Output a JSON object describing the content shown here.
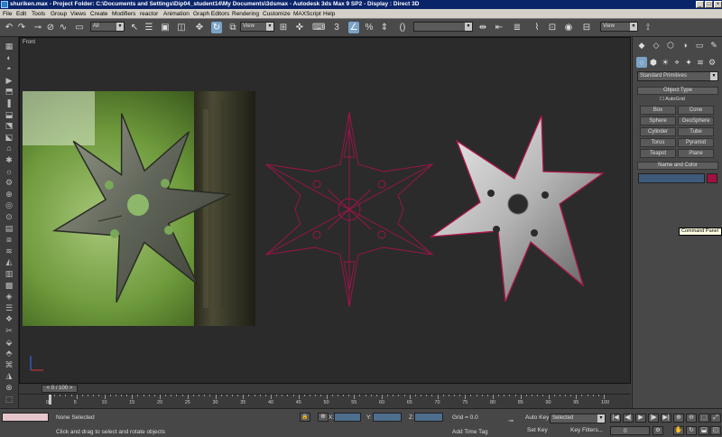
{
  "window": {
    "title": "shuriken.max - Project Folder: C:\\Documents and Settings\\Dip04_student14\\My Documents\\3dsmax - Autodesk 3ds Max 9 SP2 - Display : Direct 3D",
    "min_glyph": "_",
    "max_glyph": "□",
    "close_glyph": "×"
  },
  "menu": [
    "File",
    "Edit",
    "Tools",
    "Group",
    "Views",
    "Create",
    "Modifiers",
    "reactor",
    "Animation",
    "Graph Editors",
    "Rendering",
    "Customize",
    "MAXScript",
    "Help"
  ],
  "toolbar": {
    "undo": "↶",
    "redo": "↷",
    "link": "⊸",
    "unlink": "⊘",
    "bind": "∿",
    "selection_filter": "All",
    "select": "↖",
    "select_by_name": "☰",
    "rect_region": "▣",
    "window_crossing": "◫",
    "move": "✥",
    "rotate": "↻",
    "scale": "⧉",
    "ref_coord": "View",
    "pivot": "⊞",
    "manipulate": "✜",
    "keyboard_shortcut": "⌨",
    "snap_3d": "3",
    "angle_snap": "∠",
    "percent_snap": "%",
    "spinner_snap": "⇕",
    "named_selection": "▭",
    "edit_named": "✎",
    "mirror": "⇹",
    "align": "⇤",
    "layer_manager": "≣",
    "curve_editor": "⌇",
    "schematic_view": "⊡",
    "material_editor": "◉",
    "render_scene": "⊟",
    "render_type": "View",
    "quick_render": "⟟",
    "rotate_hint": "()"
  },
  "left_toolbar": [
    "▦",
    "◐",
    "◓",
    "▶",
    "⬒",
    "❚",
    "⬓",
    "⬔",
    "⬕",
    "⌂",
    "✱",
    "☼",
    "⚙",
    "⊕",
    "◎",
    "⊙",
    "▤",
    "⧈",
    "≋",
    "◭",
    "▥",
    "▩",
    "◈",
    "☰",
    "❖",
    "✂",
    "⬙",
    "⬘",
    "⌘",
    "◮",
    "⊗",
    "⬚"
  ],
  "viewport": {
    "label": "Front"
  },
  "command_panel": {
    "tabs": [
      "◆",
      "◇",
      "⬡",
      "◑",
      "▭",
      "✎"
    ],
    "subtabs": [
      "○",
      "⬢",
      "☀",
      "⌖",
      "✦",
      "≋",
      "⚙"
    ],
    "category": "Standard Primitives",
    "object_type_title": "Object Type",
    "autogrid": "AutoGrid",
    "buttons": [
      "Box",
      "Cone",
      "Sphere",
      "GeoSphere",
      "Cylinder",
      "Tube",
      "Torus",
      "Pyramid",
      "Teapot",
      "Plane"
    ],
    "name_color_title": "Name and Color",
    "object_color": "#a01040",
    "tooltip": "Command Panel"
  },
  "time_slider": {
    "position": "0 / 100",
    "prev": "<",
    "next": ">"
  },
  "trackbar": {
    "labels": [
      "0",
      "5",
      "10",
      "15",
      "20",
      "25",
      "30",
      "35",
      "40",
      "45",
      "50",
      "55",
      "60",
      "65",
      "70",
      "75",
      "80",
      "85",
      "90",
      "95",
      "100"
    ]
  },
  "status": {
    "selection": "None Selected",
    "prompt": "Click and drag to select and rotate objects",
    "x_label": "X:",
    "y_label": "Y:",
    "z_label": "Z:",
    "grid": "Grid = 0.0",
    "add_time_tag": "Add Time Tag",
    "auto_key": "Auto Key",
    "set_key": "Set Key",
    "selected": "Selected",
    "key_filters": "Key Filters...",
    "frame": "0",
    "play_controls": [
      "|◀",
      "◀|",
      "▶",
      "|▶",
      "▶|"
    ],
    "nav_controls": [
      "⊕",
      "⊖",
      "⬚",
      "⤢",
      "✋",
      "↻",
      "⬓",
      "◰"
    ],
    "lock_glyph": "🔒",
    "key_glyph": "⊸"
  }
}
